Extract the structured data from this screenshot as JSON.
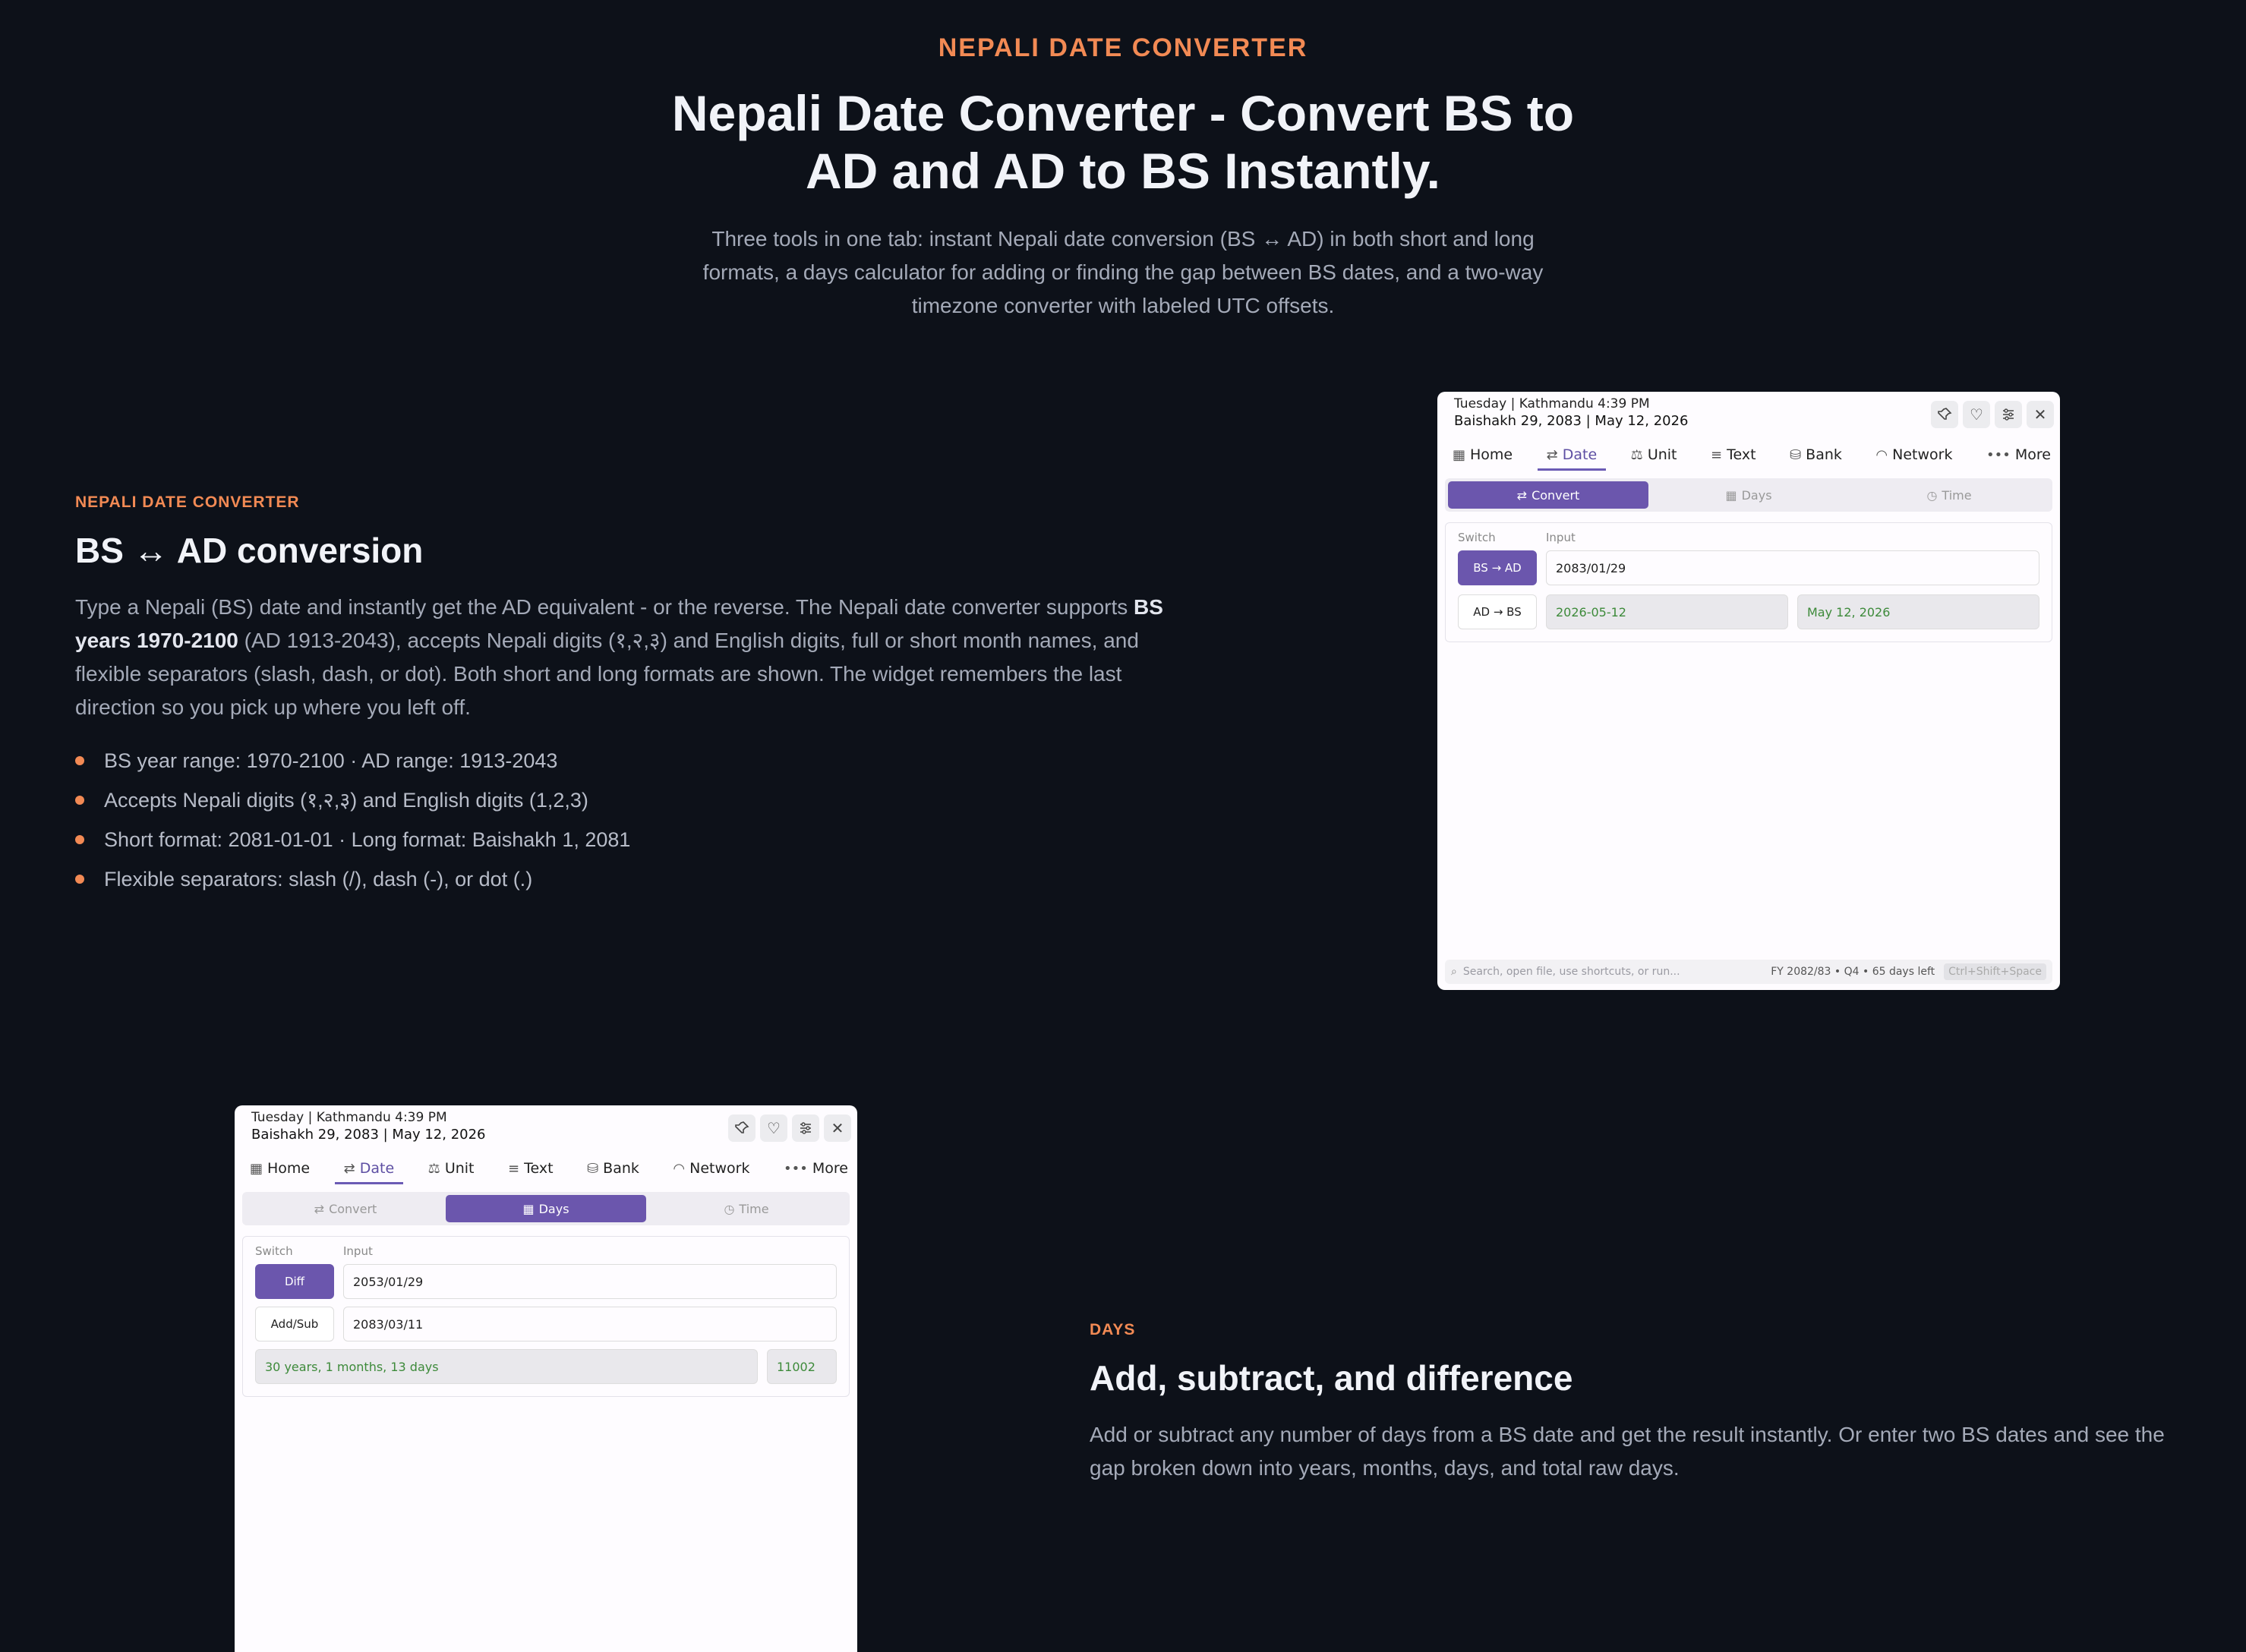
{
  "hero": {
    "eyebrow": "NEPALI DATE CONVERTER",
    "title": "Nepali Date Converter - Convert BS to AD and AD to BS Instantly.",
    "desc": "Three tools in one tab: instant Nepali date conversion (BS ↔ AD) in both short and long formats, a days calculator for adding or finding the gap between BS dates, and a two-way timezone converter with labeled UTC offsets."
  },
  "sec1": {
    "tag": "NEPALI DATE CONVERTER",
    "title": "BS ↔ AD conversion",
    "p_a": "Type a Nepali (BS) date and instantly get the AD equivalent - or the reverse. The Nepali date converter supports ",
    "p_b": "BS years 1970-2100",
    "p_c": " (AD 1913-2043), accepts Nepali digits (१,२,३) and English digits, full or short month names, and flexible separators (slash, dash, or dot). Both short and long formats are shown. The widget remembers the last direction so you pick up where you left off.",
    "bullets": [
      "BS year range: 1970-2100 · AD range: 1913-2043",
      "Accepts Nepali digits (१,२,३) and English digits (1,2,3)",
      "Short format: 2081-01-01 · Long format: Baishakh 1, 2081",
      "Flexible separators: slash (/), dash (-), or dot (.)"
    ]
  },
  "sec2": {
    "tag": "DAYS",
    "title": "Add, subtract, and difference",
    "desc": "Add or subtract any number of days from a BS date and get the result instantly. Or enter two BS dates and see the gap broken down into years, months, days, and total raw days."
  },
  "widget": {
    "line1": "Tuesday | Kathmandu 4:39 PM",
    "line2": "Baishakh 29, 2083 | May 12, 2026",
    "tabs": [
      "Home",
      "Date",
      "Unit",
      "Text",
      "Bank",
      "Network",
      "More"
    ],
    "subtabs": [
      "Convert",
      "Days",
      "Time"
    ],
    "switch_label": "Switch",
    "input_label": "Input",
    "footer_placeholder": "Search, open file, use shortcuts, or run...",
    "footer_fy": "FY 2082/83 • Q4 • 65 days left",
    "footer_kbd": "Ctrl+Shift+Space"
  },
  "convert": {
    "bs_ad": "BS → AD",
    "ad_bs": "AD → BS",
    "input": "2083/01/29",
    "out_short": "2026-05-12",
    "out_long": "May 12, 2026"
  },
  "days": {
    "diff": "Diff",
    "addsub": "Add/Sub",
    "input1": "2053/01/29",
    "input2": "2083/03/11",
    "result": "30 years, 1 months, 13 days",
    "total": "11002"
  },
  "colors": {
    "accent": "#f28a54",
    "purple": "#6b56ad",
    "bg": "#0d1119"
  }
}
